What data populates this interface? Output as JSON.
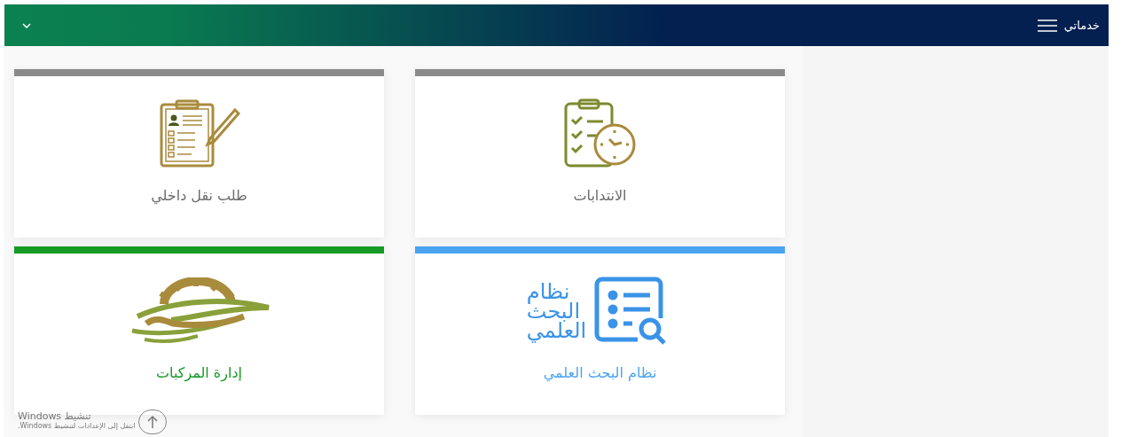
{
  "header": {
    "title": "خدماتي"
  },
  "cards": [
    {
      "kind": "delegation",
      "label": "الانتدابات",
      "color": "#8a8a8a"
    },
    {
      "kind": "transfer",
      "label": "طلب نقل داخلي",
      "color": "#8a8a8a"
    },
    {
      "kind": "research",
      "label": "نظام البحث العلمي",
      "color": "#4aa3f0",
      "logo_lines": [
        "نظام",
        "البحث",
        "العلمي"
      ]
    },
    {
      "kind": "vehicles",
      "label": "إدارة المركبات",
      "color": "#169a26"
    }
  ],
  "os_overlay": {
    "title": "تنشيط Windows",
    "subtitle": "انتقل إلى الإعدادات لتنشيط Windows."
  }
}
